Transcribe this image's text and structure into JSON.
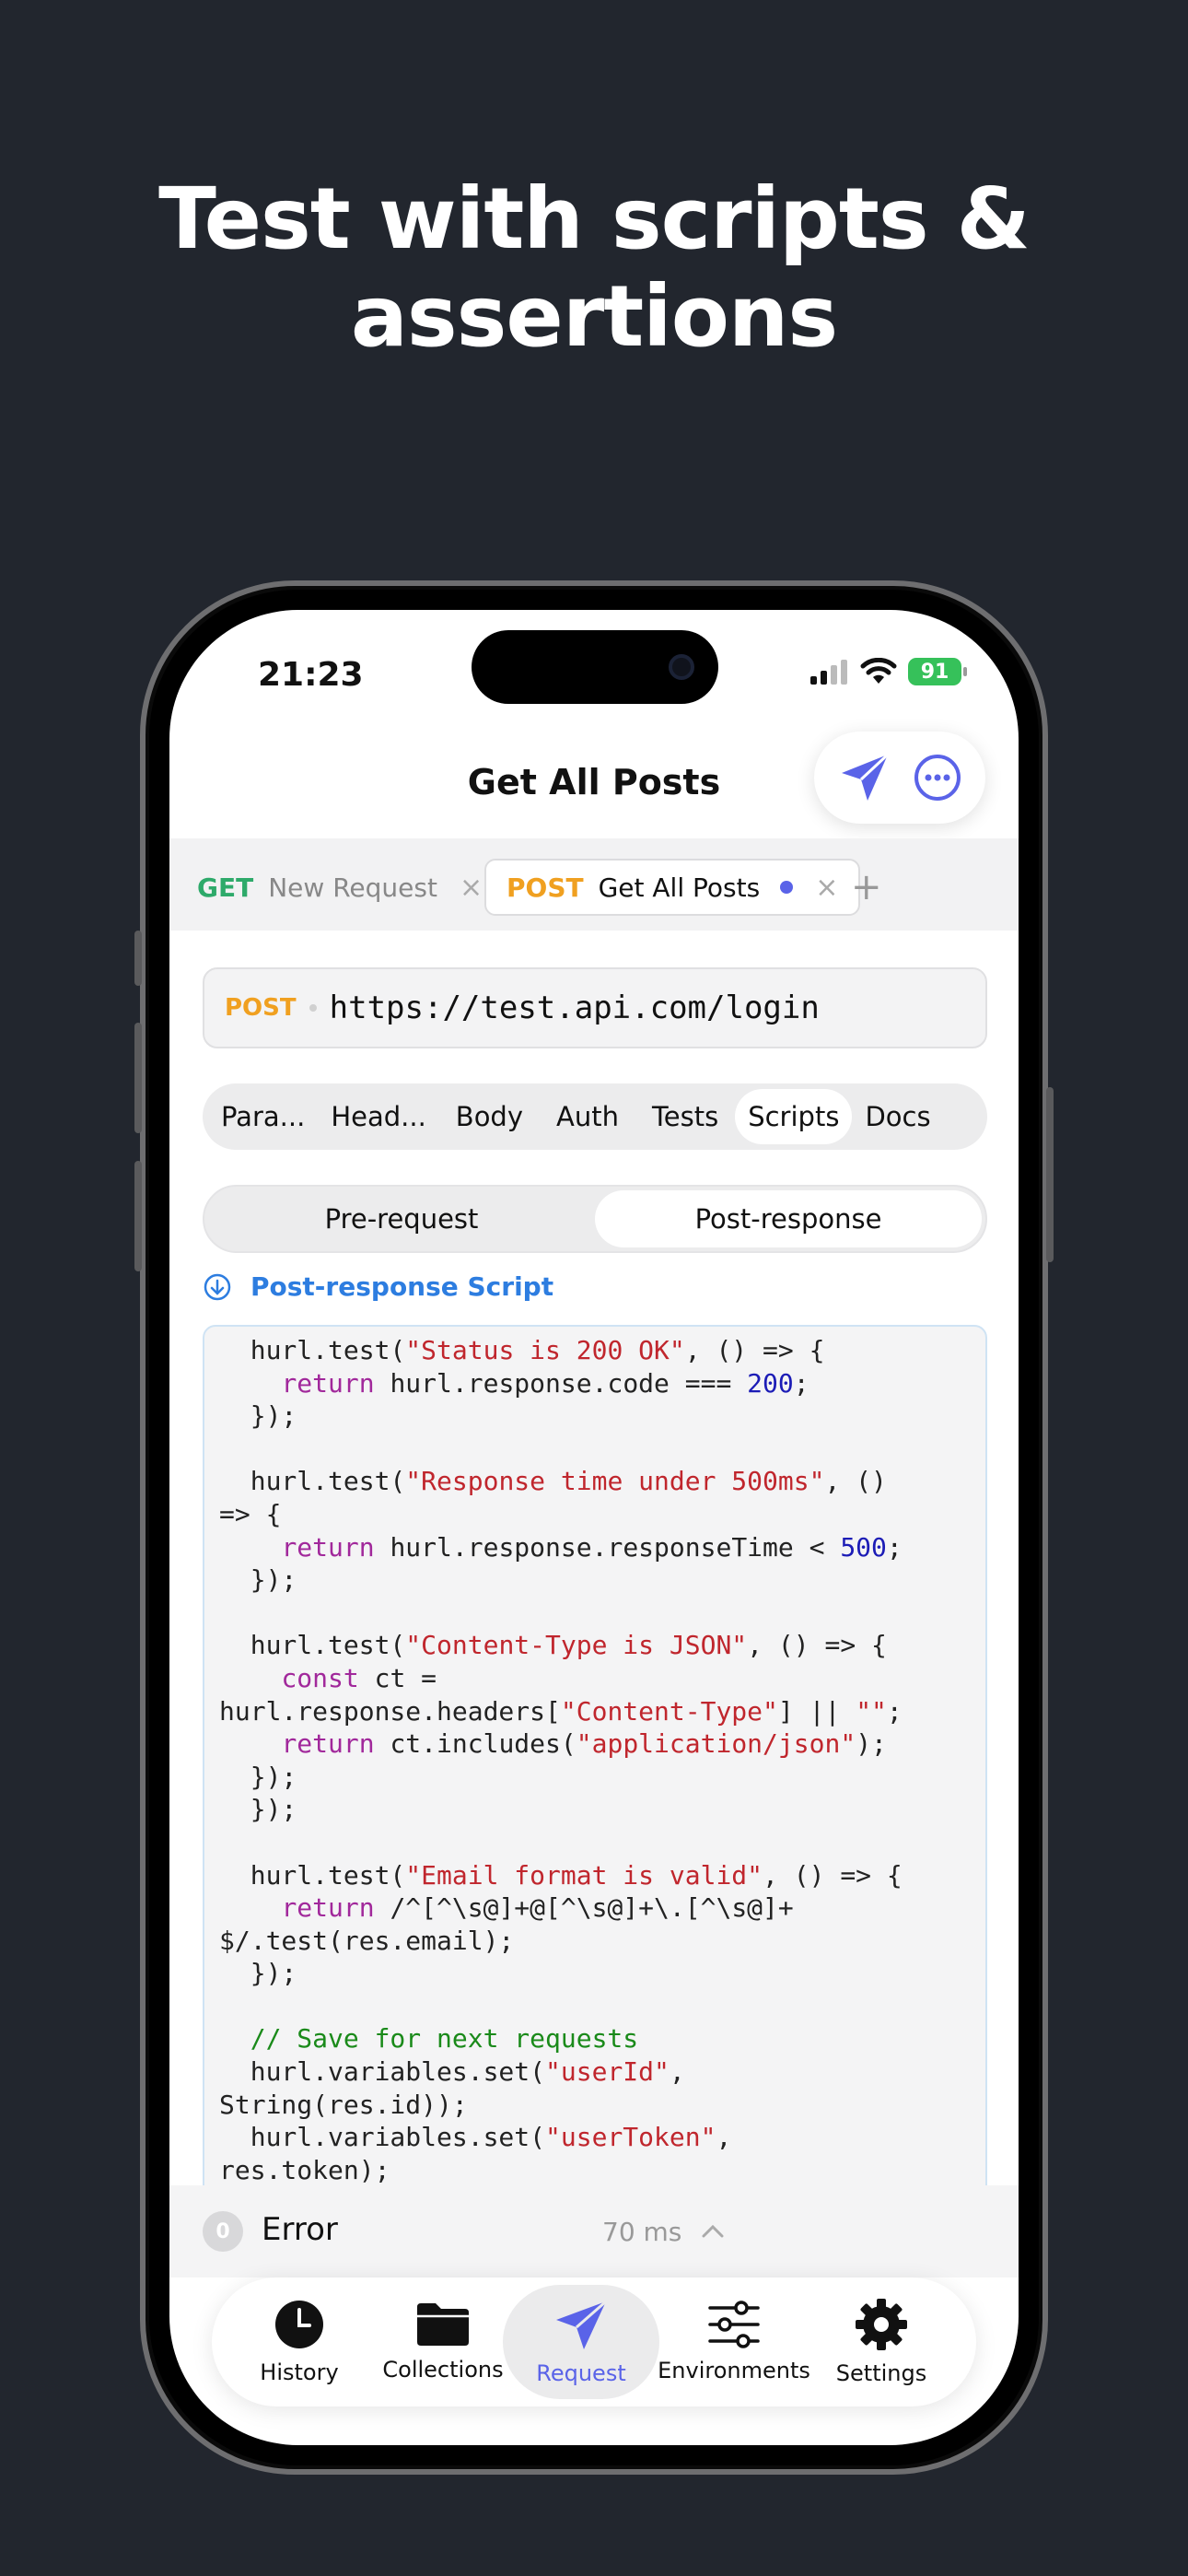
{
  "headline": [
    "Test with scripts &",
    "assertions"
  ],
  "status_bar": {
    "time": "21:23",
    "battery": "91"
  },
  "nav": {
    "title": "Get All Posts"
  },
  "request_tabs": [
    {
      "method": "GET",
      "name": "New Request"
    },
    {
      "method": "POST",
      "name": "Get All Posts"
    }
  ],
  "url_bar": {
    "method": "POST",
    "url": "https://test.api.com/login"
  },
  "section_tabs": [
    "Para...",
    "Head...",
    "Body",
    "Auth",
    "Tests",
    "Scripts",
    "Docs"
  ],
  "active_section": "Scripts",
  "script_tabs": [
    "Pre-request",
    "Post-response"
  ],
  "script_label": "Post-response Script",
  "code_lines": [
    [
      [
        "t",
        "  hurl.test("
      ],
      [
        "s",
        "\"Status is 200 OK\""
      ],
      [
        "t",
        ", () => {"
      ]
    ],
    [
      [
        "t",
        "    "
      ],
      [
        "k",
        "return"
      ],
      [
        "t",
        " hurl.response.code === "
      ],
      [
        "n",
        "200"
      ],
      [
        "t",
        ";"
      ]
    ],
    [
      [
        "t",
        "  });"
      ]
    ],
    [
      [
        "t",
        ""
      ]
    ],
    [
      [
        "t",
        "  hurl.test("
      ],
      [
        "s",
        "\"Response time under 500ms\""
      ],
      [
        "t",
        ", ()"
      ]
    ],
    [
      [
        "t",
        "=> {"
      ]
    ],
    [
      [
        "t",
        "    "
      ],
      [
        "k",
        "return"
      ],
      [
        "t",
        " hurl.response.responseTime < "
      ],
      [
        "n",
        "500"
      ],
      [
        "t",
        ";"
      ]
    ],
    [
      [
        "t",
        "  });"
      ]
    ],
    [
      [
        "t",
        ""
      ]
    ],
    [
      [
        "t",
        "  hurl.test("
      ],
      [
        "s",
        "\"Content-Type is JSON\""
      ],
      [
        "t",
        ", () => {"
      ]
    ],
    [
      [
        "t",
        "    "
      ],
      [
        "k",
        "const"
      ],
      [
        "t",
        " ct ="
      ]
    ],
    [
      [
        "t",
        "hurl.response.headers["
      ],
      [
        "s",
        "\"Content-Type\""
      ],
      [
        "t",
        "] || "
      ],
      [
        "s",
        "\"\""
      ],
      [
        "t",
        ";"
      ]
    ],
    [
      [
        "t",
        "    "
      ],
      [
        "k",
        "return"
      ],
      [
        "t",
        " ct.includes("
      ],
      [
        "s",
        "\"application/json\""
      ],
      [
        "t",
        ");"
      ]
    ],
    [
      [
        "t",
        "  });"
      ]
    ],
    [
      [
        "t",
        "  });"
      ]
    ],
    [
      [
        "t",
        ""
      ]
    ],
    [
      [
        "t",
        "  hurl.test("
      ],
      [
        "s",
        "\"Email format is valid\""
      ],
      [
        "t",
        ", () => {"
      ]
    ],
    [
      [
        "t",
        "    "
      ],
      [
        "k",
        "return"
      ],
      [
        "t",
        " /^[^\\s@]+@[^\\s@]+\\.[^\\s@]+"
      ]
    ],
    [
      [
        "t",
        "$/.test(res.email);"
      ]
    ],
    [
      [
        "t",
        "  });"
      ]
    ],
    [
      [
        "t",
        ""
      ]
    ],
    [
      [
        "c",
        "  // Save for next requests"
      ]
    ],
    [
      [
        "t",
        "  hurl.variables.set("
      ],
      [
        "s",
        "\"userId\""
      ],
      [
        "t",
        ","
      ]
    ],
    [
      [
        "t",
        "String(res.id));"
      ]
    ],
    [
      [
        "t",
        "  hurl.variables.set("
      ],
      [
        "s",
        "\"userToken\""
      ],
      [
        "t",
        ","
      ]
    ],
    [
      [
        "t",
        "res.token);"
      ]
    ]
  ],
  "response": {
    "count": "0",
    "status": "Error",
    "time": "70 ms"
  },
  "bottom_nav": [
    {
      "label": "History",
      "icon": "clock-icon"
    },
    {
      "label": "Collections",
      "icon": "folder-icon"
    },
    {
      "label": "Request",
      "icon": "send-icon"
    },
    {
      "label": "Environments",
      "icon": "sliders-icon"
    },
    {
      "label": "Settings",
      "icon": "gear-icon"
    }
  ],
  "colors": {
    "accent": "#5a63e8",
    "get": "#2eaa6a",
    "post": "#f0a020",
    "background": "#22262e"
  }
}
